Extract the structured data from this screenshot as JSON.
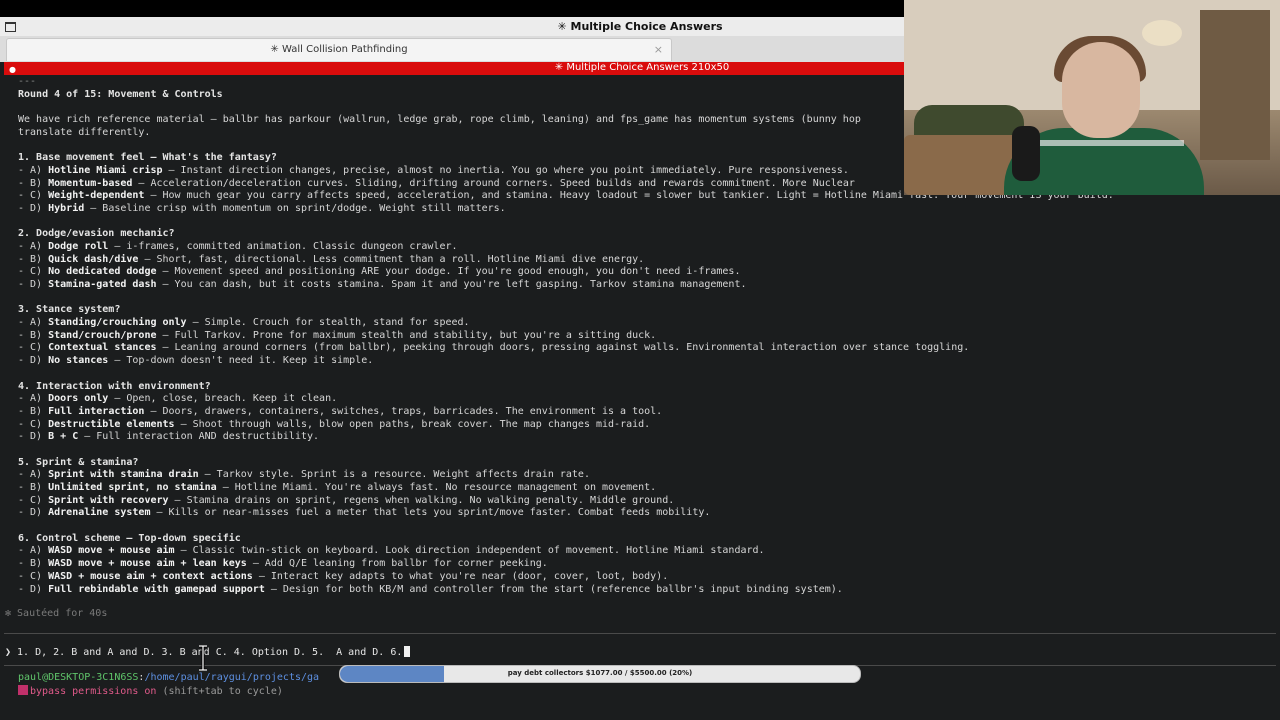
{
  "window": {
    "title": "✳ Multiple Choice Answers",
    "tab_label": "✳ Wall Collision Pathfinding",
    "tab_close": "×",
    "terminal_title": "✳ Multiple Choice Answers 210x50"
  },
  "terminal": {
    "lines": [
      {
        "segments": [
          {
            "t": "---",
            "cls": "dim"
          }
        ]
      },
      {
        "segments": [
          {
            "t": "Round 4 of 15: Movement & Controls",
            "cls": "hdr"
          }
        ]
      },
      {
        "blank": true
      },
      {
        "segments": [
          {
            "t": "We have rich reference material — ballbr has parkour (wallrun, ledge grab, rope climb, leaning) and fps_game has momentum systems (bunny hop"
          }
        ]
      },
      {
        "segments": [
          {
            "t": "translate differently."
          }
        ]
      },
      {
        "blank": true
      },
      {
        "segments": [
          {
            "t": "1. Base movement feel — What's the fantasy?",
            "cls": "hdr"
          }
        ]
      },
      {
        "segments": [
          {
            "t": "- A) "
          },
          {
            "t": "Hotline Miami crisp",
            "b": true
          },
          {
            "t": " — Instant direction changes, precise, almost no inertia. You go where you point immediately. Pure responsiveness."
          }
        ]
      },
      {
        "segments": [
          {
            "t": "- B) "
          },
          {
            "t": "Momentum-based",
            "b": true
          },
          {
            "t": " — Acceleration/deceleration curves. Sliding, drifting around corners. Speed builds and rewards commitment. More Nuclear"
          }
        ]
      },
      {
        "segments": [
          {
            "t": "- C) "
          },
          {
            "t": "Weight-dependent",
            "b": true
          },
          {
            "t": " — How much gear you carry affects speed, acceleration, and stamina. Heavy loadout = slower but tankier. Light = Hotline Miami fast. Your movement IS your build."
          }
        ]
      },
      {
        "segments": [
          {
            "t": "- D) "
          },
          {
            "t": "Hybrid",
            "b": true
          },
          {
            "t": " — Baseline crisp with momentum on sprint/dodge. Weight still matters."
          }
        ]
      },
      {
        "blank": true
      },
      {
        "segments": [
          {
            "t": "2. Dodge/evasion mechanic?",
            "cls": "hdr"
          }
        ]
      },
      {
        "segments": [
          {
            "t": "- A) "
          },
          {
            "t": "Dodge roll",
            "b": true
          },
          {
            "t": " — i-frames, committed animation. Classic dungeon crawler."
          }
        ]
      },
      {
        "segments": [
          {
            "t": "- B) "
          },
          {
            "t": "Quick dash/dive",
            "b": true
          },
          {
            "t": " — Short, fast, directional. Less commitment than a roll. Hotline Miami dive energy."
          }
        ]
      },
      {
        "segments": [
          {
            "t": "- C) "
          },
          {
            "t": "No dedicated dodge",
            "b": true
          },
          {
            "t": " — Movement speed and positioning ARE your dodge. If you're good enough, you don't need i-frames."
          }
        ]
      },
      {
        "segments": [
          {
            "t": "- D) "
          },
          {
            "t": "Stamina-gated dash",
            "b": true
          },
          {
            "t": " — You can dash, but it costs stamina. Spam it and you're left gasping. Tarkov stamina management."
          }
        ]
      },
      {
        "blank": true
      },
      {
        "segments": [
          {
            "t": "3. Stance system?",
            "cls": "hdr"
          }
        ]
      },
      {
        "segments": [
          {
            "t": "- A) "
          },
          {
            "t": "Standing/crouching only",
            "b": true
          },
          {
            "t": " — Simple. Crouch for stealth, stand for speed."
          }
        ]
      },
      {
        "segments": [
          {
            "t": "- B) "
          },
          {
            "t": "Stand/crouch/prone",
            "b": true
          },
          {
            "t": " — Full Tarkov. Prone for maximum stealth and stability, but you're a sitting duck."
          }
        ]
      },
      {
        "segments": [
          {
            "t": "- C) "
          },
          {
            "t": "Contextual stances",
            "b": true
          },
          {
            "t": " — Leaning around corners (from ballbr), peeking through doors, pressing against walls. Environmental interaction over stance toggling."
          }
        ]
      },
      {
        "segments": [
          {
            "t": "- D) "
          },
          {
            "t": "No stances",
            "b": true
          },
          {
            "t": " — Top-down doesn't need it. Keep it simple."
          }
        ]
      },
      {
        "blank": true
      },
      {
        "segments": [
          {
            "t": "4. Interaction with environment?",
            "cls": "hdr"
          }
        ]
      },
      {
        "segments": [
          {
            "t": "- A) "
          },
          {
            "t": "Doors only",
            "b": true
          },
          {
            "t": " — Open, close, breach. Keep it clean."
          }
        ]
      },
      {
        "segments": [
          {
            "t": "- B) "
          },
          {
            "t": "Full interaction",
            "b": true
          },
          {
            "t": " — Doors, drawers, containers, switches, traps, barricades. The environment is a tool."
          }
        ]
      },
      {
        "segments": [
          {
            "t": "- C) "
          },
          {
            "t": "Destructible elements",
            "b": true
          },
          {
            "t": " — Shoot through walls, blow open paths, break cover. The map changes mid-raid."
          }
        ]
      },
      {
        "segments": [
          {
            "t": "- D) "
          },
          {
            "t": "B + C",
            "b": true
          },
          {
            "t": " — Full interaction AND destructibility."
          }
        ]
      },
      {
        "blank": true
      },
      {
        "segments": [
          {
            "t": "5. Sprint & stamina?",
            "cls": "hdr"
          }
        ]
      },
      {
        "segments": [
          {
            "t": "- A) "
          },
          {
            "t": "Sprint with stamina drain",
            "b": true
          },
          {
            "t": " — Tarkov style. Sprint is a resource. Weight affects drain rate."
          }
        ]
      },
      {
        "segments": [
          {
            "t": "- B) "
          },
          {
            "t": "Unlimited sprint, no stamina",
            "b": true
          },
          {
            "t": " — Hotline Miami. You're always fast. No resource management on movement."
          }
        ]
      },
      {
        "segments": [
          {
            "t": "- C) "
          },
          {
            "t": "Sprint with recovery",
            "b": true
          },
          {
            "t": " — Stamina drains on sprint, regens when walking. No walking penalty. Middle ground."
          }
        ]
      },
      {
        "segments": [
          {
            "t": "- D) "
          },
          {
            "t": "Adrenaline system",
            "b": true
          },
          {
            "t": " — Kills or near-misses fuel a meter that lets you sprint/move faster. Combat feeds mobility."
          }
        ]
      },
      {
        "blank": true
      },
      {
        "segments": [
          {
            "t": "6. Control scheme — Top-down specific",
            "cls": "hdr"
          }
        ]
      },
      {
        "segments": [
          {
            "t": "- A) "
          },
          {
            "t": "WASD move + mouse aim",
            "b": true
          },
          {
            "t": " — Classic twin-stick on keyboard. Look direction independent of movement. Hotline Miami standard."
          }
        ]
      },
      {
        "segments": [
          {
            "t": "- B) "
          },
          {
            "t": "WASD move + mouse aim + lean keys",
            "b": true
          },
          {
            "t": " — Add Q/E leaning from ballbr for corner peeking."
          }
        ]
      },
      {
        "segments": [
          {
            "t": "- C) "
          },
          {
            "t": "WASD + mouse aim + context actions",
            "b": true
          },
          {
            "t": " — Interact key adapts to what you're near (door, cover, loot, body)."
          }
        ]
      },
      {
        "segments": [
          {
            "t": "- D) "
          },
          {
            "t": "Full rebindable with gamepad support",
            "b": true
          },
          {
            "t": " — Design for both KB/M and controller from the start (reference ballbr's input binding system)."
          }
        ]
      }
    ],
    "sauteed": "✻ Sautéed for 40s",
    "prompt_input": "❯ 1. D, 2. B and A and D. 3. B and C. 4. Option D. 5.  A and D. 6.",
    "status_user": "paul@DESKTOP-3C1N6SS",
    "status_sep": ":",
    "status_path": "/home/paul/raygui/projects/ga",
    "bypass": "bypass permissions on",
    "bypass_hint": " (shift+tab to cycle)"
  },
  "debt_bar": {
    "label": "pay debt collectors $1077.00 / $5500.00 (20%)",
    "progress": 0.2,
    "fill_color": "#5d86c4"
  },
  "icons": {
    "window_icon": "window-icon",
    "terminal_dot": "●",
    "cursor": "text-cursor-icon"
  }
}
